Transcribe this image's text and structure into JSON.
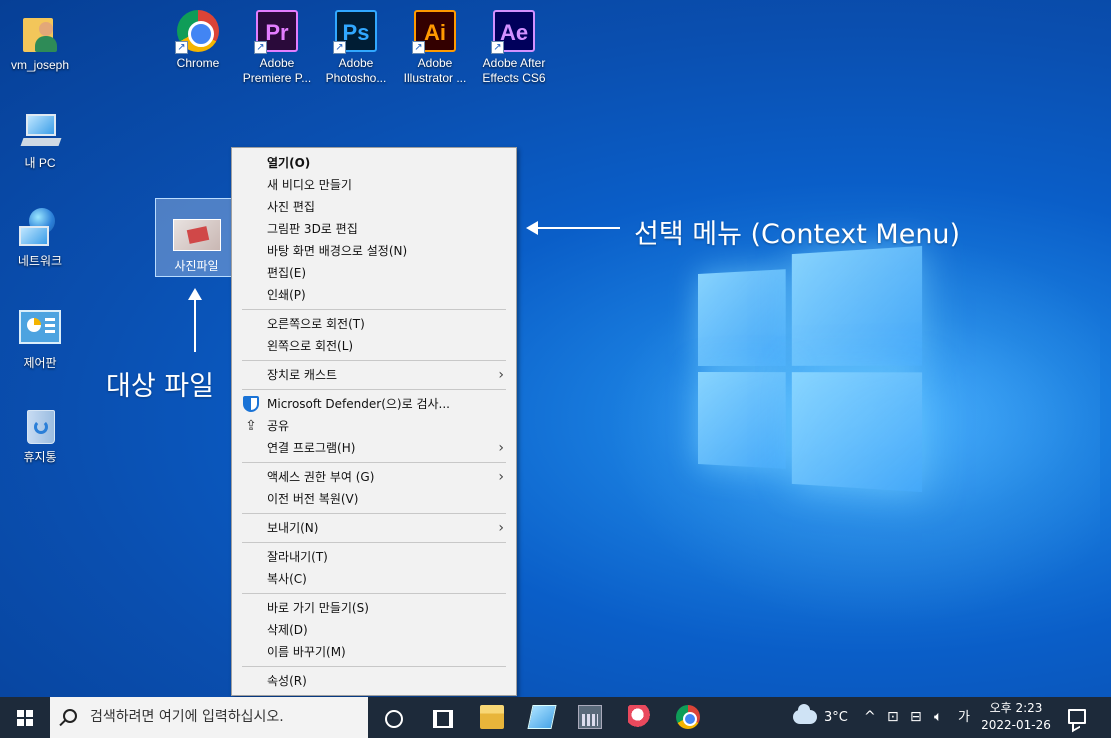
{
  "desktop": {
    "icons": [
      {
        "label": "vm_joseph",
        "icon": "user-folder-icon"
      },
      {
        "label": "Chrome",
        "icon": "chrome-icon"
      },
      {
        "label": "Adobe Premiere P...",
        "icon": "premiere-icon",
        "glyph": "Pr"
      },
      {
        "label": "Adobe Photosho...",
        "icon": "photoshop-icon",
        "glyph": "Ps"
      },
      {
        "label": "Adobe Illustrator ...",
        "icon": "illustrator-icon",
        "glyph": "Ai"
      },
      {
        "label": "Adobe After Effects CS6",
        "icon": "after-effects-icon",
        "glyph": "Ae"
      },
      {
        "label": "내 PC",
        "icon": "this-pc-icon"
      },
      {
        "label": "네트워크",
        "icon": "network-icon"
      },
      {
        "label": "제어판",
        "icon": "control-panel-icon"
      },
      {
        "label": "휴지통",
        "icon": "recycle-bin-icon"
      }
    ],
    "selected_file": {
      "label": "사진파일"
    }
  },
  "annotations": {
    "menu_label": "선택 메뉴 (Context Menu)",
    "target_label": "대상 파일"
  },
  "context_menu": {
    "groups": [
      [
        {
          "label": "열기(O)",
          "bold": true
        },
        {
          "label": "새 비디오 만들기"
        },
        {
          "label": "사진 편집"
        },
        {
          "label": "그림판 3D로 편집"
        },
        {
          "label": "바탕 화면 배경으로 설정(N)"
        },
        {
          "label": "편집(E)"
        },
        {
          "label": "인쇄(P)"
        }
      ],
      [
        {
          "label": "오른쪽으로 회전(T)"
        },
        {
          "label": "왼쪽으로 회전(L)"
        }
      ],
      [
        {
          "label": "장치로 캐스트",
          "submenu": true
        }
      ],
      [
        {
          "label": "Microsoft Defender(으)로 검사...",
          "icon": "defender-shield-icon"
        },
        {
          "label": "공유",
          "icon": "share-icon"
        },
        {
          "label": "연결 프로그램(H)",
          "submenu": true
        }
      ],
      [
        {
          "label": "액세스 권한 부여 (G)",
          "submenu": true
        },
        {
          "label": "이전 버전 복원(V)"
        }
      ],
      [
        {
          "label": "보내기(N)",
          "submenu": true
        }
      ],
      [
        {
          "label": "잘라내기(T)"
        },
        {
          "label": "복사(C)"
        }
      ],
      [
        {
          "label": "바로 가기 만들기(S)"
        },
        {
          "label": "삭제(D)"
        },
        {
          "label": "이름 바꾸기(M)"
        }
      ],
      [
        {
          "label": "속성(R)"
        }
      ]
    ]
  },
  "taskbar": {
    "search_placeholder": "검색하려면 여기에 입력하십시오.",
    "weather": "3°C",
    "tray_chevron": "^",
    "ime": "가",
    "time": "오후 2:23",
    "date": "2022-01-26"
  }
}
